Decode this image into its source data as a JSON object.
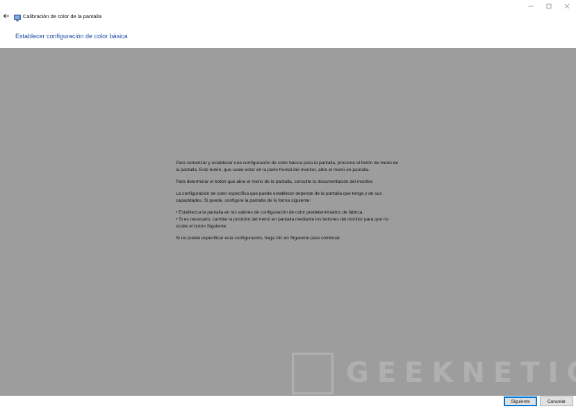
{
  "window": {
    "title": "Calibración de color de la pantalla",
    "controls": [
      "minimize",
      "maximize",
      "close"
    ]
  },
  "header": {
    "title": "Establecer configuración de color básica"
  },
  "instructions": {
    "p1": "Para comenzar y establecer una configuración de color básica para la pantalla, presione el botón de menú de la pantalla. Este botón, que suele estar en la parte frontal del monitor, abre el menú en pantalla.",
    "p2": "Para determinar el botón que abre el menú de la pantalla, consulte la documentación del monitor.",
    "p3": "La configuración de color específica que puede establecer depende de la pantalla que tenga y de sus capacidades. Si puede, configure la pantalla de la forma siguiente:",
    "bullet1": "• Establezca la pantalla en los valores de configuración de color predeterminados de fábrica.",
    "bullet2": "• Si es necesario, cambie la posición del menú en pantalla mediante los botones del monitor para que no oculte el botón Siguiente.",
    "p4": "Si no puede especificar esta configuración, haga clic en Siguiente para continuar."
  },
  "watermark": {
    "text": "GEEKNETIC"
  },
  "footer": {
    "next_label": "Siguiente",
    "cancel_label": "Cancelar"
  },
  "colors": {
    "content_bg": "#9d9d9d",
    "title_blue": "#1a4aa0",
    "accent": "#0078d7"
  }
}
